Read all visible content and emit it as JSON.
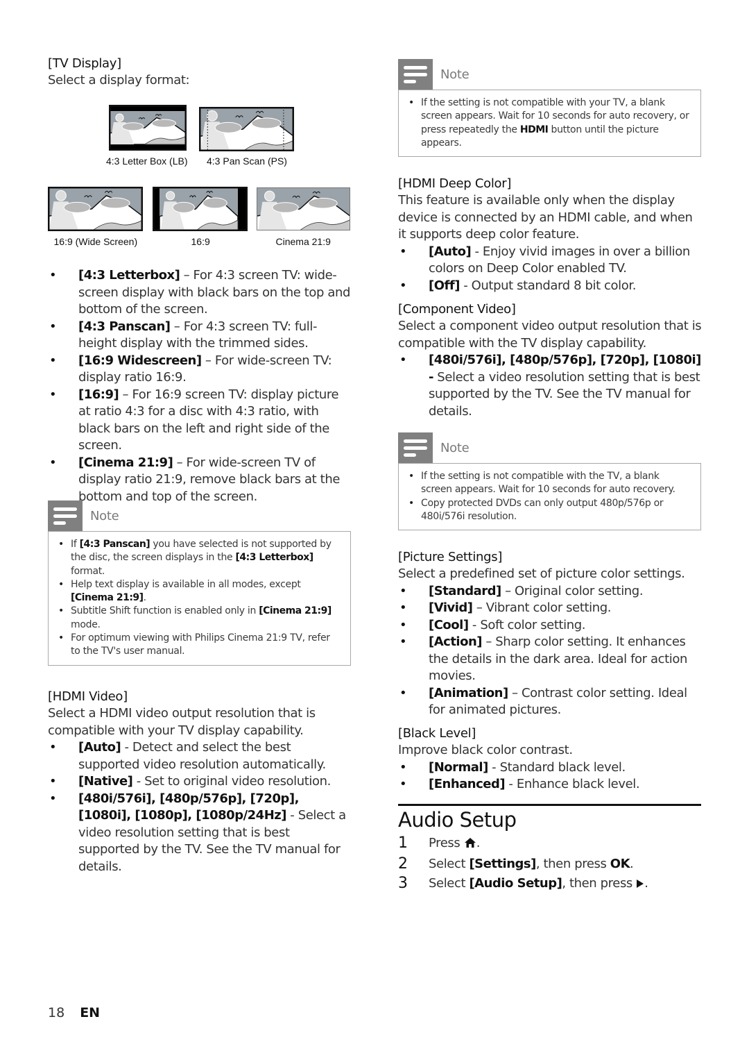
{
  "left": {
    "tv_display": {
      "title": "[TV Display]",
      "desc": "Select a display format:",
      "images": [
        {
          "caption": "4:3 Letter Box (LB)",
          "style": "letterbox"
        },
        {
          "caption": "4:3 Pan Scan (PS)",
          "style": "panscan"
        },
        {
          "caption": "16:9 (Wide Screen)",
          "style": "wide"
        },
        {
          "caption": "16:9",
          "style": "pillar"
        },
        {
          "caption": "Cinema 21:9",
          "style": "cinema"
        }
      ],
      "bullets": [
        {
          "term": "[4:3 Letterbox]",
          "text": " – For 4:3 screen TV: wide-screen display with black bars on the top and bottom of the screen."
        },
        {
          "term": "[4:3 Panscan]",
          "text": " – For 4:3 screen TV: full-height display with the trimmed sides."
        },
        {
          "term": "[16:9 Widescreen]",
          "text": " – For wide-screen TV: display ratio 16:9."
        },
        {
          "term": "[16:9]",
          "text": " – For 16:9 screen TV: display picture at ratio 4:3 for a disc with 4:3 ratio, with black bars on the left and right side of the screen."
        },
        {
          "term": "[Cinema 21:9]",
          "text": " – For wide-screen TV of display ratio 21:9, remove black bars at the bottom and top of the screen."
        }
      ]
    },
    "note": {
      "title": "Note",
      "items": [
        {
          "a": "If ",
          "b1": "[4:3 Panscan]",
          "c": " you have selected is not supported by the disc, the screen displays in the ",
          "b2": "[4:3 Letterbox]",
          "d": " format."
        },
        {
          "a": "Help text display is available in all modes, except ",
          "b1": "[Cinema 21:9]",
          "c": ".",
          "b2": "",
          "d": ""
        },
        {
          "a": "Subtitle Shift function is enabled only in ",
          "b1": "[Cinema 21:9]",
          "c": " mode.",
          "b2": "",
          "d": ""
        },
        {
          "a": "For optimum viewing with Philips Cinema 21:9 TV, refer to the TV's user manual.",
          "b1": "",
          "c": "",
          "b2": "",
          "d": ""
        }
      ]
    },
    "hdmi_video": {
      "title": "[HDMI Video]",
      "desc": "Select a HDMI video output resolution that is compatible with your TV display capability.",
      "bullets": [
        {
          "term": "[Auto]",
          "text": " - Detect and select the best supported video resolution automatically."
        },
        {
          "term": "[Native]",
          "text": " - Set to original video resolution."
        },
        {
          "term": "[480i/576i], [480p/576p], [720p], [1080i], [1080p], [1080p/24Hz]",
          "text": " - Select a video resolution setting that is best supported by the TV. See the TV manual for details."
        }
      ]
    }
  },
  "right": {
    "note1": {
      "title": "Note",
      "items": [
        {
          "a": "If the setting is not compatible with your TV, a blank screen appears. Wait for 10 seconds for auto recovery, or press repeatedly the ",
          "b1": "HDMI",
          "c": " button until the picture appears.",
          "b2": "",
          "d": ""
        }
      ]
    },
    "hdmi_deep_color": {
      "title": "[HDMI Deep Color]",
      "desc": "This feature is available only when the display device is connected by an HDMI cable, and when it supports deep color feature.",
      "bullets": [
        {
          "term": "[Auto]",
          "text": " - Enjoy vivid images in over a billion colors on Deep Color enabled TV."
        },
        {
          "term": "[Off]",
          "text": " - Output standard 8 bit color."
        }
      ]
    },
    "component_video": {
      "title": "[Component Video]",
      "desc": "Select a component video output resolution that is compatible with the TV display capability.",
      "bullets": [
        {
          "term": "[480i/576i], [480p/576p], [720p], [1080i] -",
          "text": " Select a video resolution setting that is best supported by the TV. See the TV manual for details."
        }
      ]
    },
    "note2": {
      "title": "Note",
      "items": [
        {
          "a": "If the setting is not compatible with the TV, a blank screen appears. Wait for 10 seconds for auto recovery.",
          "b1": "",
          "c": "",
          "b2": "",
          "d": ""
        },
        {
          "a": "Copy protected DVDs can only output 480p/576p or 480i/576i resolution.",
          "b1": "",
          "c": "",
          "b2": "",
          "d": ""
        }
      ]
    },
    "picture_settings": {
      "title": "[Picture Settings]",
      "desc": "Select a predefined set of picture color settings.",
      "bullets": [
        {
          "term": "[Standard]",
          "text": " – Original color setting."
        },
        {
          "term": "[Vivid]",
          "text": " – Vibrant color setting."
        },
        {
          "term": "[Cool]",
          "text": " - Soft color setting."
        },
        {
          "term": "[Action]",
          "text": " – Sharp color setting. It enhances the details in the dark area. Ideal for action movies."
        },
        {
          "term": "[Animation]",
          "text": " – Contrast color setting. Ideal for animated pictures."
        }
      ]
    },
    "black_level": {
      "title": "[Black Level]",
      "desc": "Improve black color contrast.",
      "bullets": [
        {
          "term": "[Normal]",
          "text": " - Standard black level."
        },
        {
          "term": "[Enhanced]",
          "text": " - Enhance black level."
        }
      ]
    },
    "audio_setup": {
      "heading": "Audio Setup",
      "steps": [
        {
          "num": "1",
          "pre": "Press ",
          "b1": "",
          "mid": "",
          "b2": "",
          "icon": "home-icon",
          "post": "."
        },
        {
          "num": "2",
          "pre": "Select ",
          "b1": "[Settings]",
          "mid": ", then press ",
          "b2": "OK",
          "icon": "",
          "post": "."
        },
        {
          "num": "3",
          "pre": "Select ",
          "b1": "[Audio Setup]",
          "mid": ", then press ",
          "b2": "",
          "icon": "play-right-icon",
          "post": "."
        }
      ]
    }
  },
  "footer": {
    "page_number": "18",
    "language": "EN"
  },
  "colors": {
    "note_icon_bg": "#808080",
    "note_border": "#a8a8a8",
    "text": "#333333",
    "sky": "#9aa3aa"
  }
}
